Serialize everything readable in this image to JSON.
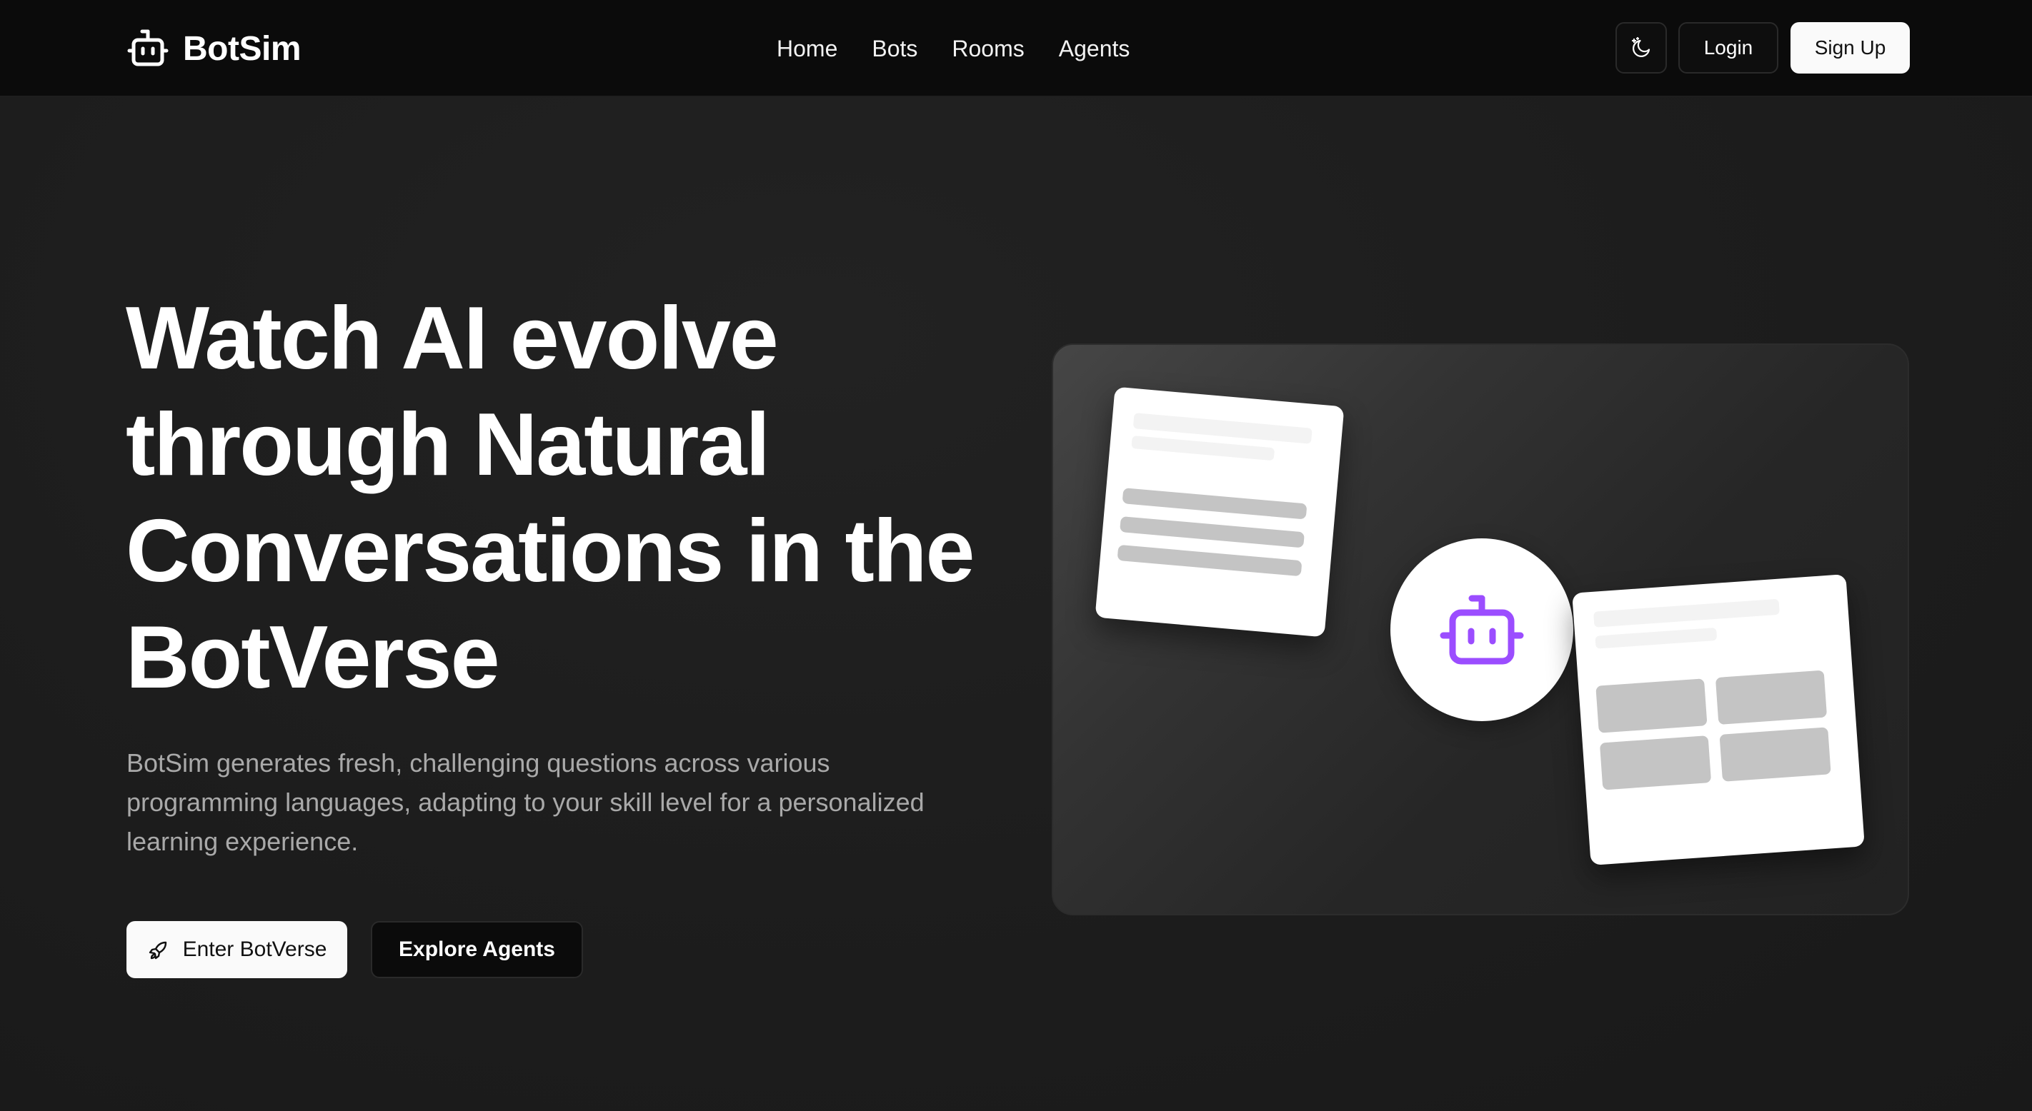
{
  "brand": {
    "name": "BotSim",
    "icon": "bot-icon"
  },
  "nav": {
    "links": [
      "Home",
      "Bots",
      "Rooms",
      "Agents"
    ]
  },
  "header_actions": {
    "theme_icon": "moon-stars-icon",
    "login_label": "Login",
    "signup_label": "Sign Up"
  },
  "hero": {
    "title_lines": [
      "Watch AI evolve",
      "through Natural",
      "Conversations in the",
      "BotVerse"
    ],
    "description_lines": [
      "BotSim generates fresh, challenging questions across various",
      "programming languages, adapting to your skill level for a personalized",
      "learning experience."
    ],
    "primary_cta": {
      "label": "Enter BotVerse",
      "icon": "rocket-icon"
    },
    "secondary_cta": {
      "label": "Explore Agents"
    }
  },
  "illustration": {
    "center_icon": "bot-icon",
    "accent_color": "#9b4dff"
  },
  "colors": {
    "background": "#1c1c1c",
    "navbar": "#0b0b0b",
    "text_muted": "#a9a9a9",
    "button_light": "#fafafa"
  }
}
